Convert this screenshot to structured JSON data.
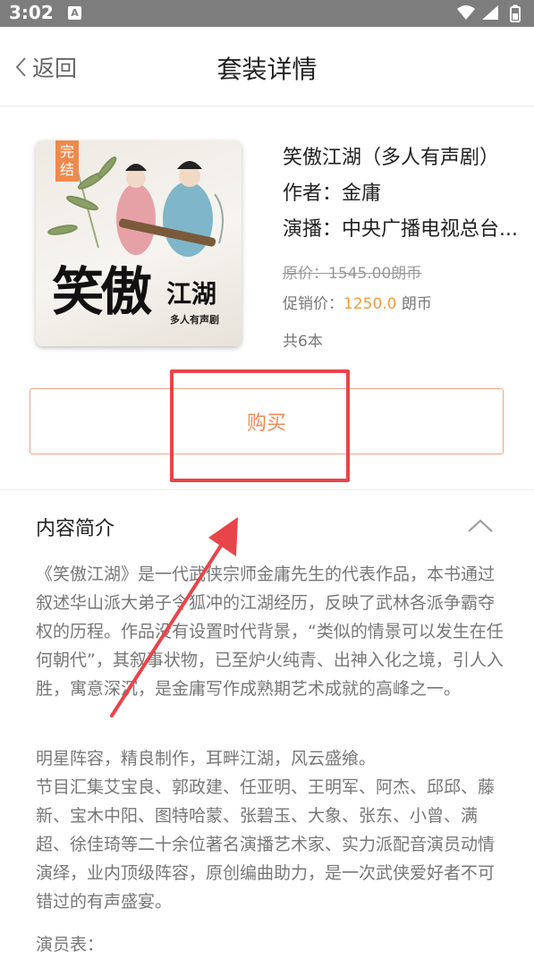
{
  "status_bar": {
    "time": "3:02",
    "notification_icon": "A"
  },
  "nav": {
    "back_label": "返回",
    "title": "套装详情"
  },
  "book": {
    "cover": {
      "status_tag": "完结",
      "title_big": "笑傲",
      "title_small": "江湖",
      "subtitle": "多人有声剧"
    },
    "title": "笑傲江湖（多人有声剧）",
    "author_label": "作者：",
    "author": "金庸",
    "cast_label": "演播：",
    "cast": "中央广播电视总台...",
    "original_price": "原价：1545.00朗币",
    "promo_label": "促销价：",
    "promo_value": "1250.0",
    "promo_unit": "朗币",
    "count": "共6本"
  },
  "buy_label": "购买",
  "intro": {
    "title": "内容简介",
    "paragraphs": [
      "《笑傲江湖》是一代武侠宗师金庸先生的代表作品，本书通过叙述华山派大弟子令狐冲的江湖经历，反映了武林各派争霸夺权的历程。作品没有设置时代背景，“类似的情景可以发生在任何朝代”，其叙事状物，已至炉火纯青、出神入化之境，引人入胜，寓意深沉，是金庸写作成熟期艺术成就的高峰之一。",
      "明星阵容，精良制作，耳畔江湖，风云盛飨。\n节目汇集艾宝良、郭政建、任亚明、王明军、阿杰、邱邱、藤新、宝木中阳、图特哈蒙、张碧玉、大象、张东、小曾、满超、徐佳琦等二十余位著名演播艺术家、实力派配音演员动情演绎，业内顶级阵容，原创编曲助力，是一次武侠爱好者不可错过的有声盛宴。",
      "演员表："
    ]
  },
  "colors": {
    "accent": "#f08a55",
    "price": "#f39c3d",
    "annotation": "#e8454a"
  },
  "icons": [
    "chevron-left-icon",
    "chevron-up-icon",
    "wifi-icon",
    "cell-signal-icon",
    "battery-icon"
  ]
}
